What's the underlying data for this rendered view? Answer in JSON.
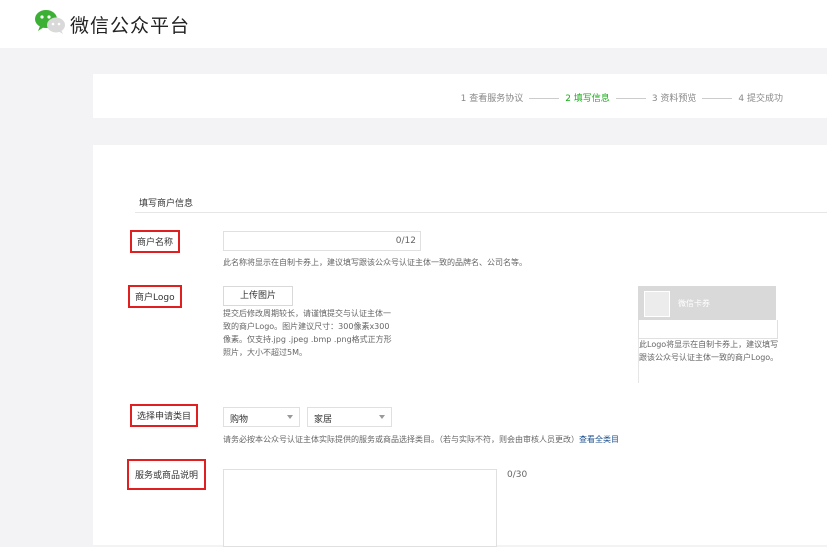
{
  "header": {
    "brand": "微信公众平台"
  },
  "steps": [
    {
      "label": "1 查看服务协议",
      "active": false
    },
    {
      "label": "2 填写信息",
      "active": true
    },
    {
      "label": "3 资料预览",
      "active": false
    },
    {
      "label": "4 提交成功",
      "active": false
    }
  ],
  "form": {
    "section_title": "填写商户信息",
    "name": {
      "label": "商户名称",
      "value": "",
      "counter": "0/12",
      "hint": "此名称将显示在自制卡券上，建议填写跟该公众号认证主体一致的品牌名、公司名等。"
    },
    "logo": {
      "label": "商户Logo",
      "upload_button": "上传图片",
      "hint": "提交后修改周期较长，请谨慎提交与认证主体一致的商户Logo。图片建议尺寸：300像素x300像素。仅支持.jpg .jpeg .bmp .png格式正方形照片，大小不超过5M。",
      "preview_title": "微信卡券",
      "preview_hint": "此Logo将显示在自制卡券上，建议填写跟该公众号认证主体一致的商户Logo。"
    },
    "category": {
      "label": "选择申请类目",
      "select1": "购物",
      "select2": "家居",
      "hint": "请务必按本公众号认证主体实际提供的服务或商品选择类目。（若与实际不符，则会由审核人员更改）",
      "link": "查看全类目"
    },
    "description": {
      "label": "服务或商品说明",
      "value": "",
      "counter": "0/30"
    }
  },
  "colors": {
    "accent": "#1aad19",
    "highlight_border": "#e02020",
    "link": "#1a4e8c"
  }
}
